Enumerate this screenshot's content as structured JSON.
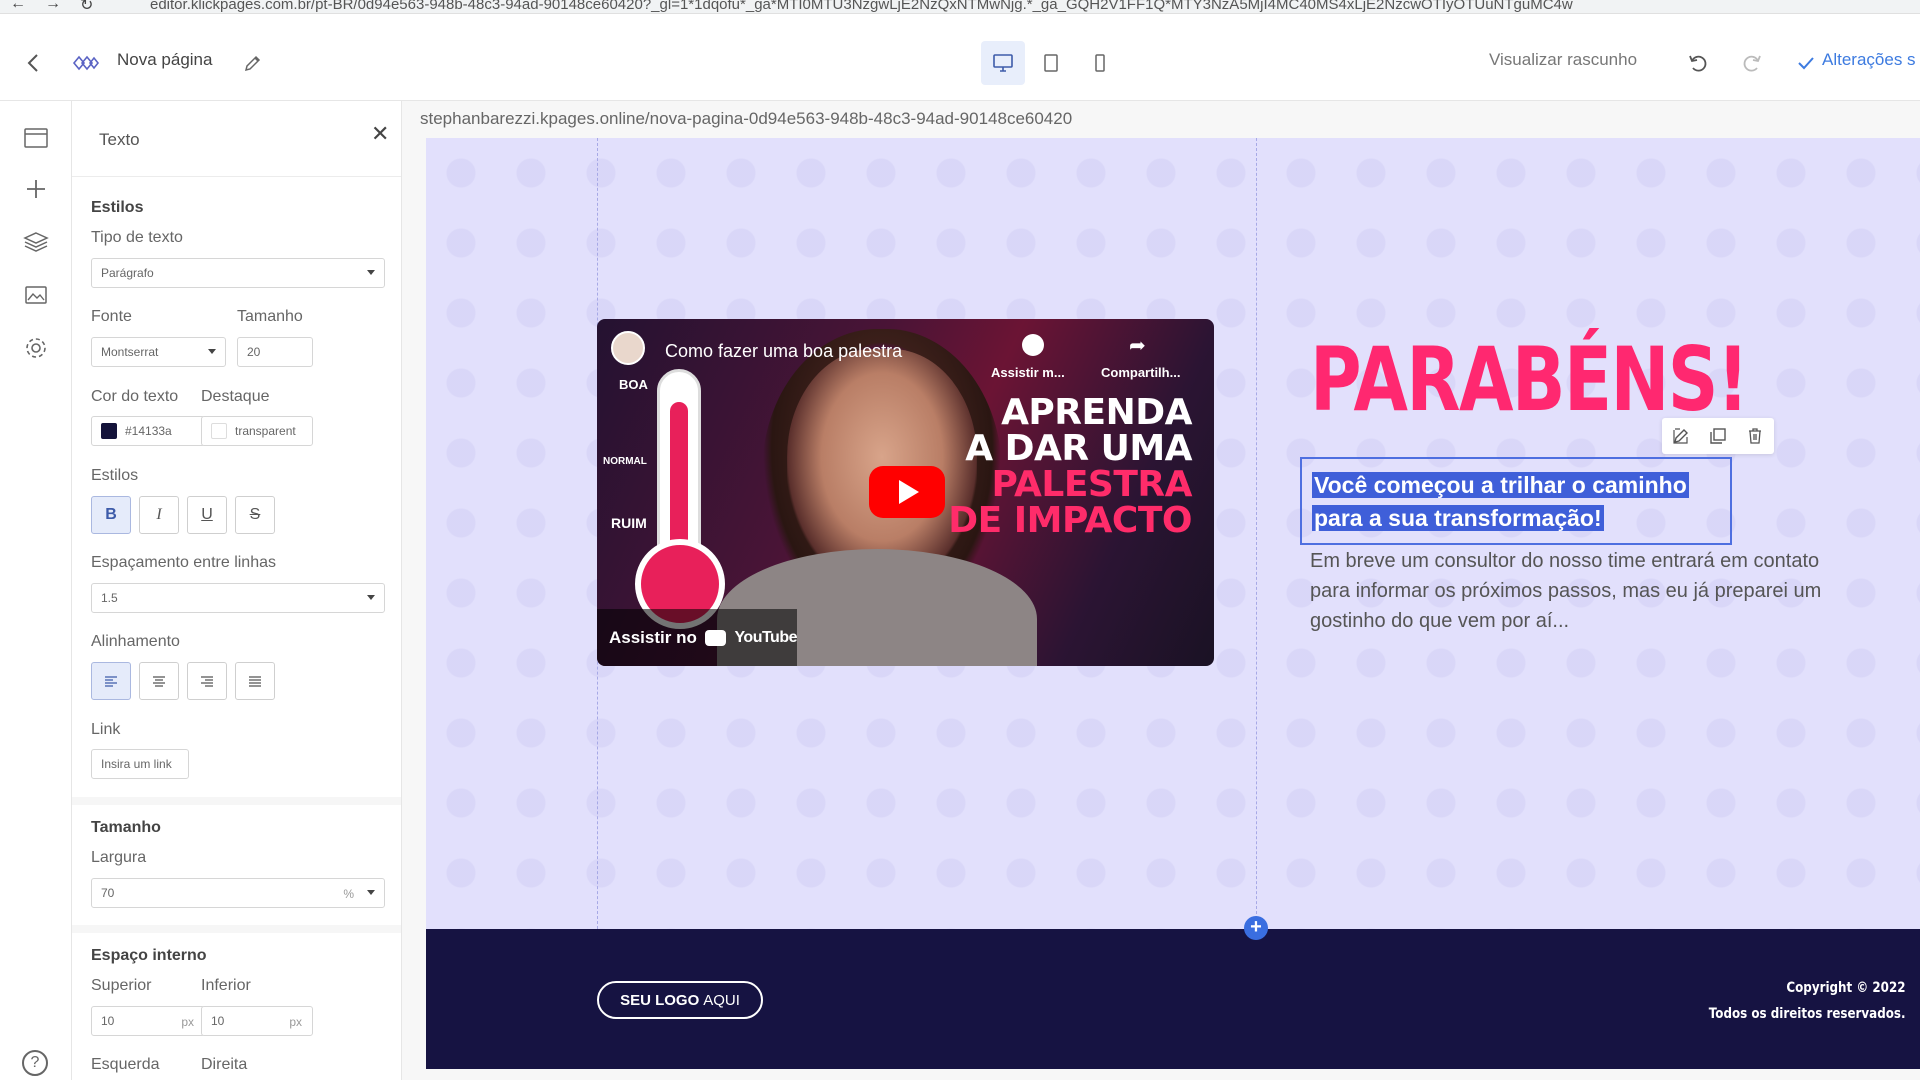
{
  "browser": {
    "url": "editor.klickpages.com.br/pt-BR/0d94e563-948b-48c3-94ad-90148ce60420?_gl=1*1dqofu*_ga*MTI0MTU3NzgwLjE2NzQxNTMwNjg.*_ga_GQH2V1FF1Q*MTY3NzA5MjI4MC40MS4xLjE2NzcwOTIyOTUuNTguMC4w"
  },
  "toolbar": {
    "page_title": "Nova página",
    "preview_label": "Visualizar rascunho",
    "saved_label": "Alterações s",
    "active_device": "desktop"
  },
  "panel": {
    "title": "Texto",
    "styles_section": "Estilos",
    "text_type_label": "Tipo de texto",
    "text_type_value": "Parágrafo",
    "font_label": "Fonte",
    "font_value": "Montserrat",
    "size_label": "Tamanho",
    "size_value": "20",
    "text_color_label": "Cor do texto",
    "text_color_value": "#14133a",
    "highlight_label": "Destaque",
    "highlight_value": "transparent",
    "format_label": "Estilos",
    "format_buttons": {
      "bold": "B",
      "italic": "I",
      "underline": "U",
      "strike": "S"
    },
    "line_spacing_label": "Espaçamento entre linhas",
    "line_spacing_value": "1.5",
    "alignment_label": "Alinhamento",
    "link_label": "Link",
    "link_placeholder": "Insira um link",
    "size_section": "Tamanho",
    "width_label": "Largura",
    "width_value": "70",
    "width_unit": "%",
    "padding_section": "Espaço interno",
    "top_label": "Superior",
    "top_value": "10",
    "bottom_label": "Inferior",
    "bottom_value": "10",
    "px_unit": "px",
    "left_label": "Esquerda",
    "right_label": "Direita"
  },
  "canvas": {
    "url": "stephanbarezzi.kpages.online/nova-pagina-0d94e563-948b-48c3-94ad-90148ce60420",
    "video": {
      "title": "Como fazer uma boa palestra",
      "watch_later": "Assistir m...",
      "share": "Compartilh...",
      "headline_1": "APRENDA",
      "headline_2": "A DAR UMA",
      "headline_3": "PALESTRA",
      "headline_4": "DE IMPACTO",
      "thermo_top": "BOA",
      "thermo_mid": "NORMAL",
      "thermo_bot": "RUIM",
      "watch_on": "Assistir no",
      "youtube": "YouTube"
    },
    "heading": "PARABÉNS!",
    "selected_line_1": "Você começou a trilhar o caminho",
    "selected_line_2": "para a sua transformação!",
    "body_text": "Em breve um consultor do nosso time entrará em contato para informar os próximos passos, mas eu já preparei um gostinho do que vem por aí...",
    "footer": {
      "logo_strong": "SEU LOGO",
      "logo_rest": "AQUI",
      "copyright": "Copyright © 2022",
      "rights": "Todos os direitos reservados."
    }
  },
  "colors": {
    "accent": "#3d7be0",
    "heading": "#ff2870",
    "footer_bg": "#161342",
    "hero_bg": "#e2e0fc",
    "text_color_swatch": "#14133a"
  }
}
